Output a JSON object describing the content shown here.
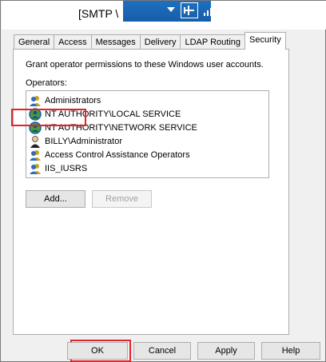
{
  "window": {
    "title": "[SMTP \\"
  },
  "tabs": [
    {
      "label": "General"
    },
    {
      "label": "Access"
    },
    {
      "label": "Messages"
    },
    {
      "label": "Delivery"
    },
    {
      "label": "LDAP Routing"
    },
    {
      "label": "Security"
    }
  ],
  "active_tab": "Security",
  "security": {
    "description": "Grant operator permissions to these Windows user accounts.",
    "operators_label": "Operators:",
    "operators": [
      {
        "name": "Administrators",
        "icon": "group-icon"
      },
      {
        "name": "NT AUTHORITY\\LOCAL SERVICE",
        "icon": "globe-user-icon"
      },
      {
        "name": "NT AUTHORITY\\NETWORK SERVICE",
        "icon": "globe-user-icon"
      },
      {
        "name": "BILLY\\Administrator",
        "icon": "user-icon"
      },
      {
        "name": "Access Control Assistance Operators",
        "icon": "group-icon"
      },
      {
        "name": "IIS_IUSRS",
        "icon": "group-icon"
      }
    ],
    "selected_operator": "IIS_IUSRS",
    "add_label": "Add...",
    "remove_label": "Remove"
  },
  "footer": {
    "ok_label": "OK",
    "cancel_label": "Cancel",
    "apply_label": "Apply",
    "help_label": "Help"
  },
  "colors": {
    "highlight": "#e0242b",
    "title_bar_blue": "#1a66b5"
  }
}
